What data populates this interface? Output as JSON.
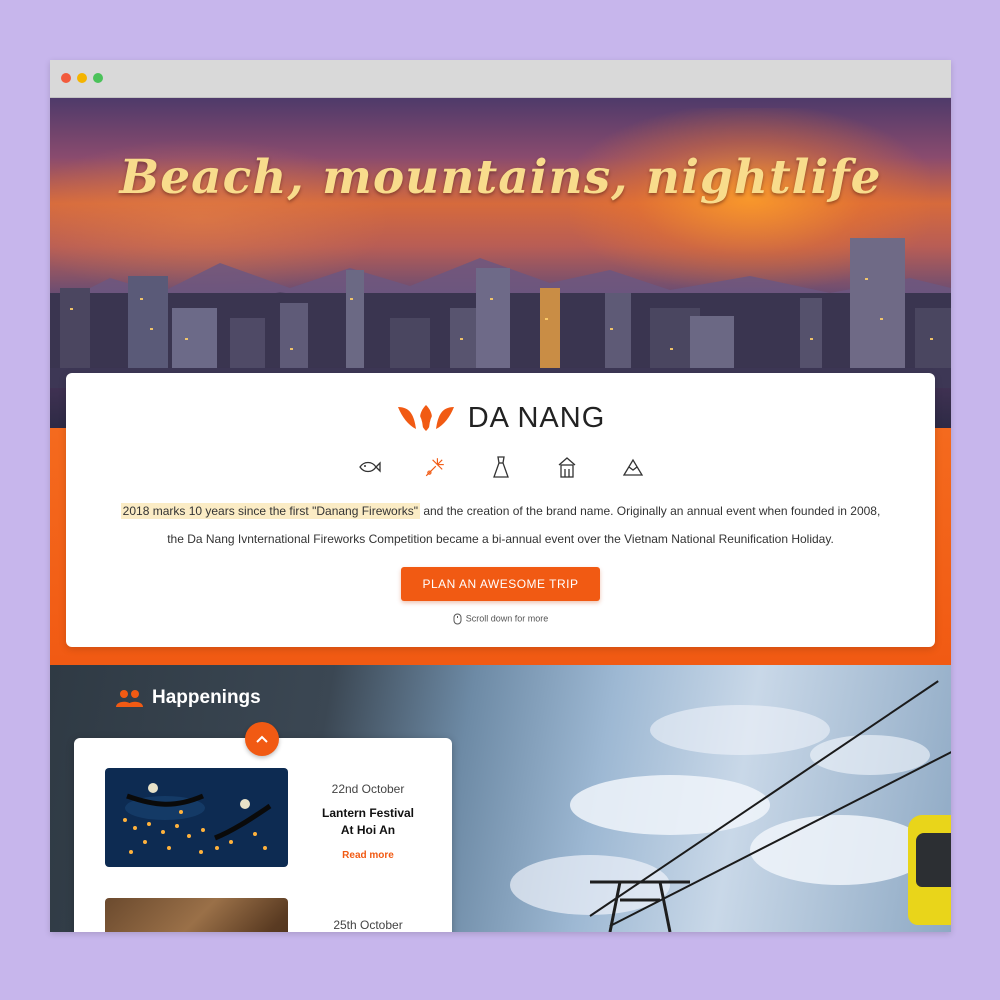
{
  "hero": {
    "title": "Beach, mountains, nightlife"
  },
  "brand": {
    "name": "DA NANG",
    "logo_icon": "danang-lotus-logo",
    "accent_color": "#f15a13"
  },
  "categories": [
    {
      "icon": "fish-icon"
    },
    {
      "icon": "fireworks-icon"
    },
    {
      "icon": "dress-icon"
    },
    {
      "icon": "landmark-icon"
    },
    {
      "icon": "mountain-icon"
    }
  ],
  "intro": {
    "highlight": "2018 marks 10 years since the first \"Danang Fireworks\"",
    "line1_rest": " and the creation of the brand name. Originally an annual event when founded in 2008,",
    "line2": "the Da Nang Ivnternational Fireworks Competition became a bi-annual event over the Vietnam National Reunification Holiday."
  },
  "cta": {
    "label": "PLAN AN AWESOME TRIP"
  },
  "scroll_hint": "Scroll down for more",
  "happenings": {
    "heading": "Happenings",
    "heading_icon": "people-icon",
    "events": [
      {
        "date": "22nd October",
        "title_line1": "Lantern Festival",
        "title_line2": "At Hoi An",
        "link": "Read more"
      },
      {
        "date": "25th October"
      }
    ]
  }
}
